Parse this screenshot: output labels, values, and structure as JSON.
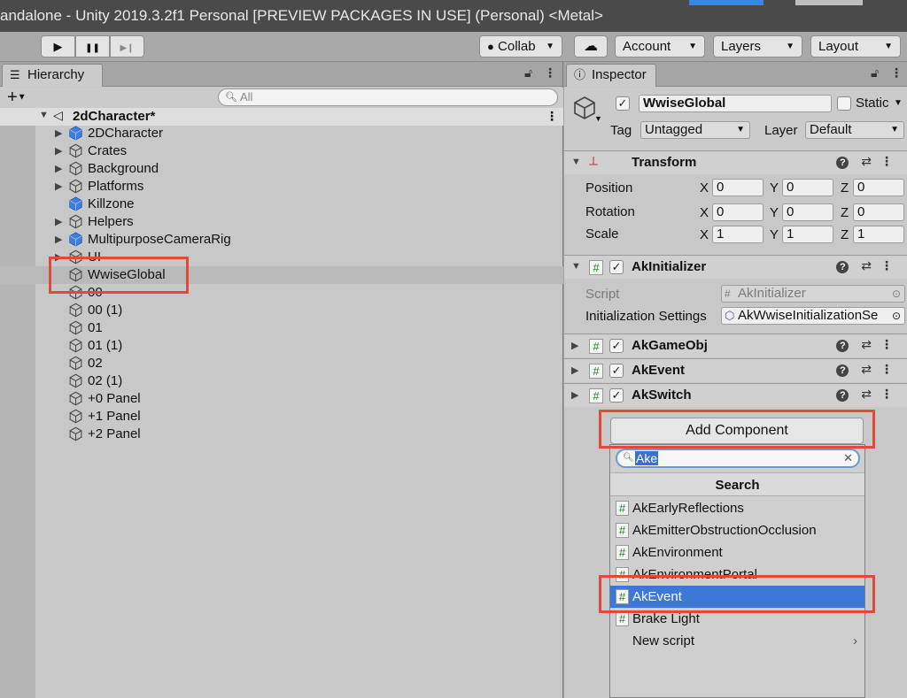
{
  "window": {
    "title": "andalone - Unity 2019.3.2f1 Personal [PREVIEW PACKAGES IN USE] (Personal) <Metal>"
  },
  "toolbar": {
    "play": "▶",
    "pause": "❚❚",
    "step": "▶❙",
    "collab": "Collab",
    "account": "Account",
    "layers": "Layers",
    "layout": "Layout"
  },
  "hierarchy": {
    "tab_label": "Hierarchy",
    "search_placeholder": "All",
    "scene_name": "2dCharacter*",
    "items": [
      {
        "label": "2DCharacter",
        "expandable": true,
        "prefab": true
      },
      {
        "label": "Crates",
        "expandable": true,
        "prefab": false
      },
      {
        "label": "Background",
        "expandable": true,
        "prefab": false
      },
      {
        "label": "Platforms",
        "expandable": true,
        "prefab": false
      },
      {
        "label": "Killzone",
        "expandable": false,
        "prefab": true
      },
      {
        "label": "Helpers",
        "expandable": true,
        "prefab": false
      },
      {
        "label": "MultipurposeCameraRig",
        "expandable": true,
        "prefab": true
      },
      {
        "label": "UI",
        "expandable": true,
        "prefab": false
      },
      {
        "label": "WwiseGlobal",
        "expandable": false,
        "prefab": false,
        "selected": true
      },
      {
        "label": "00",
        "expandable": false,
        "prefab": false
      },
      {
        "label": "00 (1)",
        "expandable": false,
        "prefab": false
      },
      {
        "label": "01",
        "expandable": false,
        "prefab": false
      },
      {
        "label": "01 (1)",
        "expandable": false,
        "prefab": false
      },
      {
        "label": "02",
        "expandable": false,
        "prefab": false
      },
      {
        "label": "02 (1)",
        "expandable": false,
        "prefab": false
      },
      {
        "label": "+0 Panel",
        "expandable": false,
        "prefab": false
      },
      {
        "label": "+1 Panel",
        "expandable": false,
        "prefab": false
      },
      {
        "label": "+2 Panel",
        "expandable": false,
        "prefab": false
      }
    ]
  },
  "inspector": {
    "tab_label": "Inspector",
    "object_name": "WwiseGlobal",
    "static_label": "Static",
    "tag_label": "Tag",
    "tag_value": "Untagged",
    "layer_label": "Layer",
    "layer_value": "Default",
    "transform": {
      "title": "Transform",
      "position_label": "Position",
      "rotation_label": "Rotation",
      "scale_label": "Scale",
      "x": "X",
      "y": "Y",
      "z": "Z",
      "position": [
        "0",
        "0",
        "0"
      ],
      "rotation": [
        "0",
        "0",
        "0"
      ],
      "scale": [
        "1",
        "1",
        "1"
      ]
    },
    "ak_initializer": {
      "title": "AkInitializer",
      "script_label": "Script",
      "script_value": "AkInitializer",
      "init_settings_label": "Initialization Settings",
      "init_settings_value": "AkWwiseInitializationSe"
    },
    "components": [
      "AkGameObj",
      "AkEvent",
      "AkSwitch"
    ],
    "add_component": "Add Component"
  },
  "popup": {
    "search_value": "Ake",
    "title": "Search",
    "items": [
      {
        "label": "AkEarlyReflections",
        "script": true
      },
      {
        "label": "AkEmitterObstructionOcclusion",
        "script": true
      },
      {
        "label": "AkEnvironment",
        "script": true
      },
      {
        "label": "AkEnvironmentPortal",
        "script": true
      },
      {
        "label": "AkEvent",
        "script": true,
        "highlighted": true
      },
      {
        "label": "Brake Light",
        "script": true
      },
      {
        "label": "New script",
        "script": false,
        "submenu": true
      }
    ]
  },
  "colors": {
    "highlight": "#3d78d6",
    "annotation_box": "#e04a3a",
    "prefab_cube": "#3b7fdc"
  }
}
